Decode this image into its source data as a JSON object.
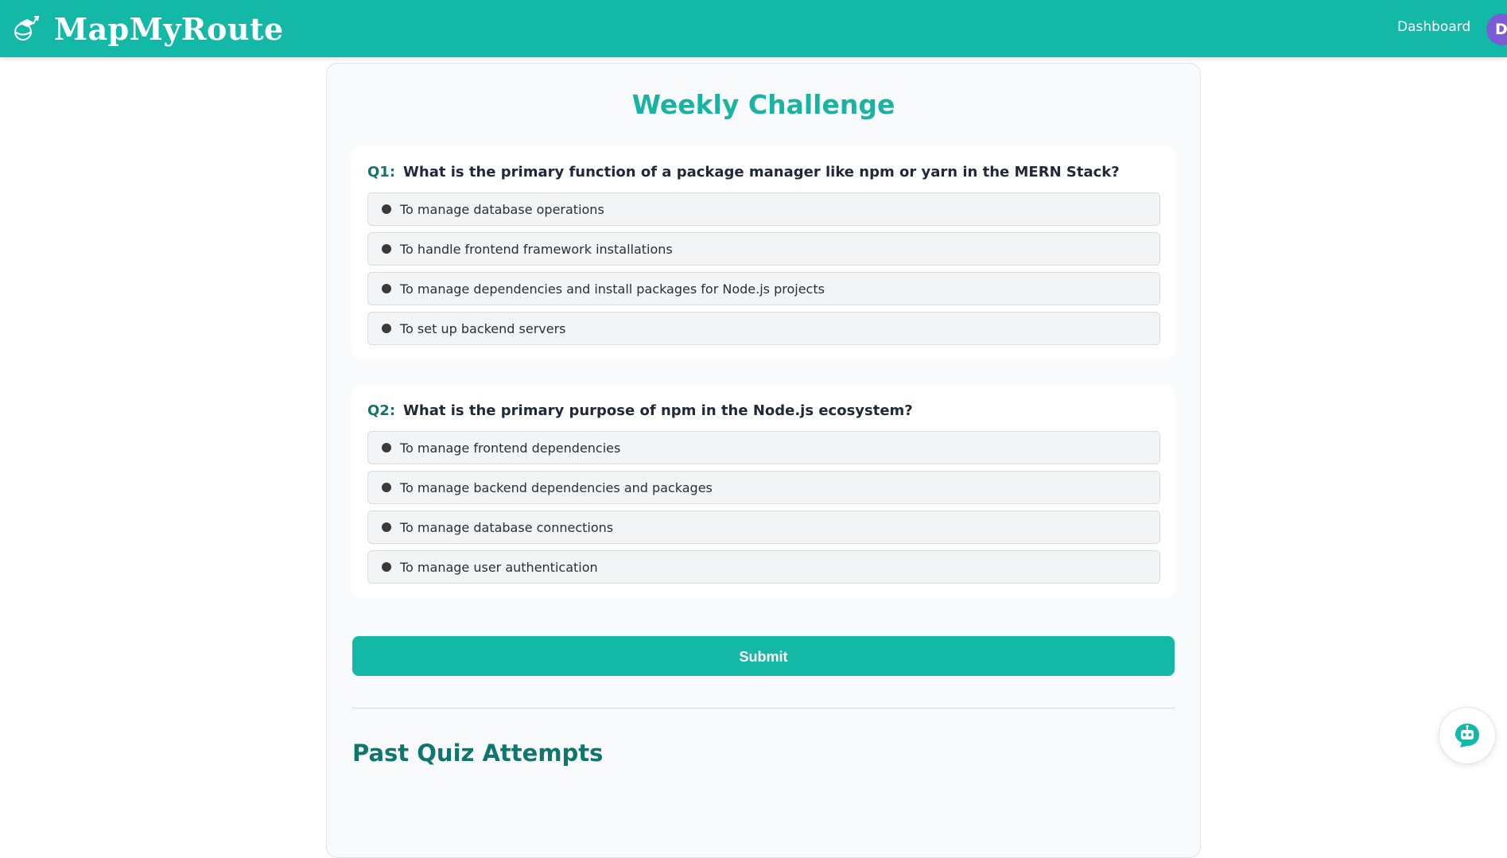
{
  "app": {
    "name": "MapMyRoute",
    "brand_icon": "graduation-cap-icon"
  },
  "nav": {
    "dashboard_label": "Dashboard",
    "avatar_initial": "D"
  },
  "challenge": {
    "title": "Weekly Challenge",
    "questions": [
      {
        "number": "Q1:",
        "text": "What is the primary function of a package manager like npm or yarn in the MERN Stack?",
        "options": [
          "To manage database operations",
          "To handle frontend framework installations",
          "To manage dependencies and install packages for Node.js projects",
          "To set up backend servers"
        ]
      },
      {
        "number": "Q2:",
        "text": "What is the primary purpose of npm in the Node.js ecosystem?",
        "options": [
          "To manage frontend dependencies",
          "To manage backend dependencies and packages",
          "To manage database connections",
          "To manage user authentication"
        ]
      }
    ],
    "submit_label": "Submit"
  },
  "past_attempts": {
    "title": "Past Quiz Attempts"
  },
  "chat_widget": {
    "icon": "chatbot-icon"
  },
  "colors": {
    "brand": "#14b8a6",
    "title": "#1ab3a2",
    "question_number": "#0f766e",
    "avatar": "#7c5cd6"
  }
}
